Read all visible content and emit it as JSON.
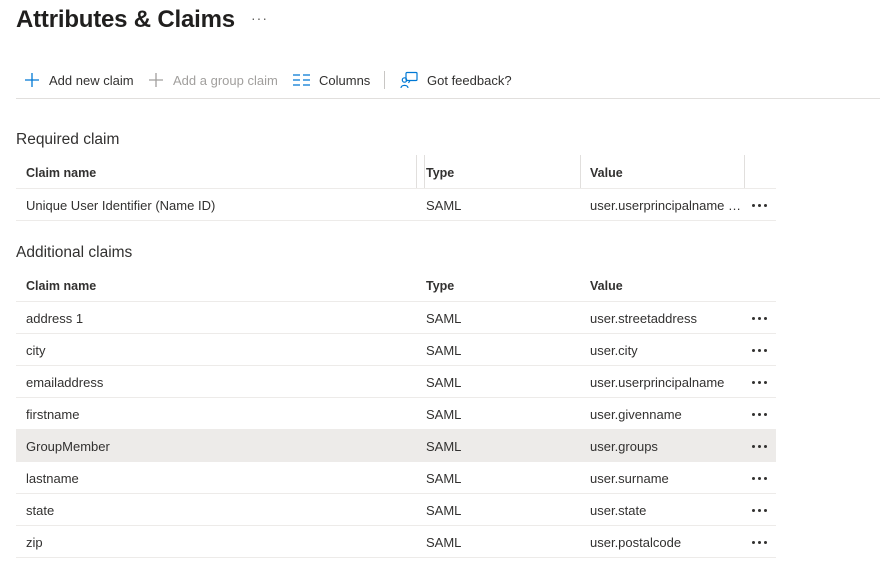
{
  "page": {
    "title": "Attributes & Claims",
    "more_label": "···"
  },
  "toolbar": {
    "add_new_claim": "Add new claim",
    "add_group_claim": "Add a group claim",
    "columns": "Columns",
    "feedback": "Got feedback?"
  },
  "required": {
    "title": "Required claim",
    "headers": {
      "name": "Claim name",
      "type": "Type",
      "value": "Value"
    },
    "rows": [
      {
        "name": "Unique User Identifier (Name ID)",
        "type": "SAML",
        "value": "user.userprincipalname [..."
      }
    ]
  },
  "additional": {
    "title": "Additional claims",
    "headers": {
      "name": "Claim name",
      "type": "Type",
      "value": "Value"
    },
    "rows": [
      {
        "name": "address 1",
        "type": "SAML",
        "value": "user.streetaddress"
      },
      {
        "name": "city",
        "type": "SAML",
        "value": "user.city"
      },
      {
        "name": "emailaddress",
        "type": "SAML",
        "value": "user.userprincipalname"
      },
      {
        "name": "firstname",
        "type": "SAML",
        "value": "user.givenname"
      },
      {
        "name": "GroupMember",
        "type": "SAML",
        "value": "user.groups"
      },
      {
        "name": "lastname",
        "type": "SAML",
        "value": "user.surname"
      },
      {
        "name": "state",
        "type": "SAML",
        "value": "user.state"
      },
      {
        "name": "zip",
        "type": "SAML",
        "value": "user.postalcode"
      }
    ],
    "selected_row": "GroupMember"
  },
  "colors": {
    "accent": "#0078d4",
    "disabled": "#a19f9d",
    "selected_row": "#edebe9",
    "border": "#edebe9"
  },
  "icons": {
    "add": "plus-icon",
    "add_group": "plus-icon",
    "columns": "columns-icon",
    "feedback": "feedback-icon",
    "row_more": "more-icon"
  }
}
